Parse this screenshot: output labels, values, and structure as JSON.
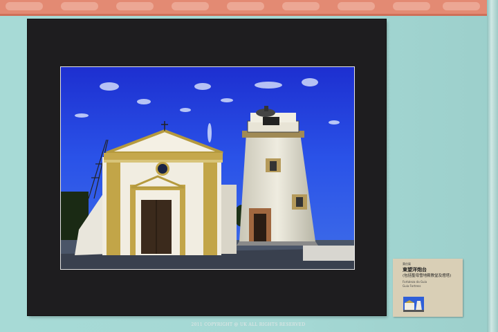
{
  "caption_card": {
    "title_line1": "東望洋炮台",
    "title_line2": "(包括聖母雪地殿教堂及燈塔)",
    "subtitle_pt": "Fortaleza da Guia",
    "subtitle_en": "Guia Fortress",
    "credit": "葉伯鳳",
    "thumbnail": "photo-thumbnail"
  },
  "photo": {
    "subject": "chapel-and-lighthouse-photo"
  },
  "watermark": {
    "text": "2011 COPYRIGHT @ UK ALL RIGHTS RESERVED"
  }
}
